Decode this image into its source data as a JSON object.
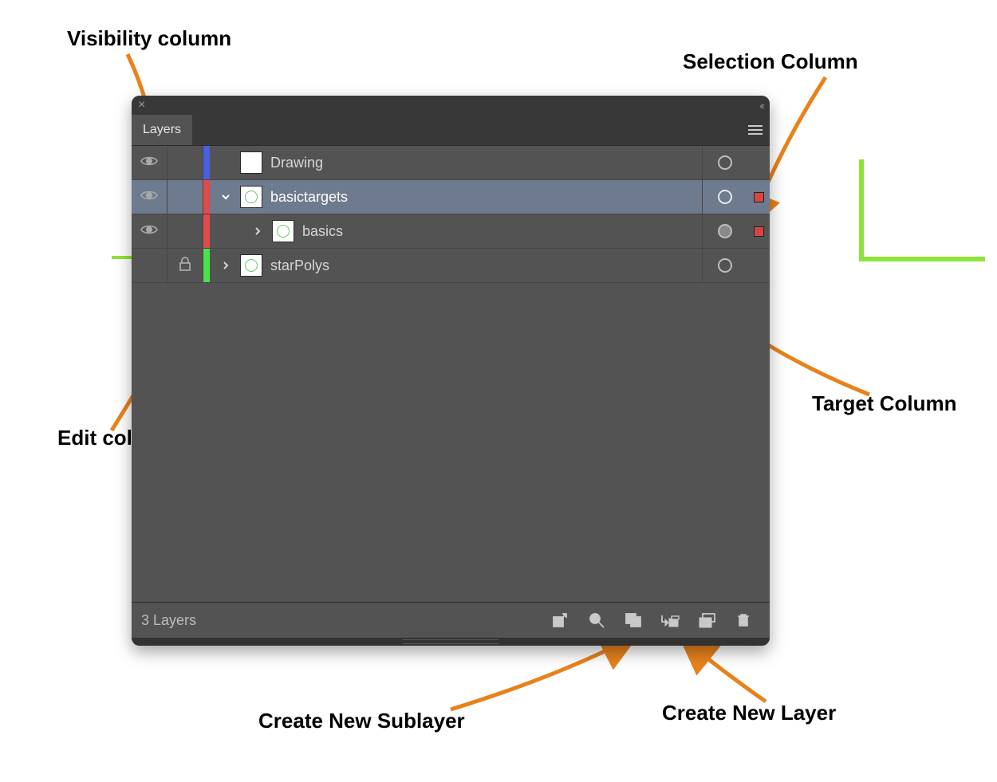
{
  "annotations": {
    "visibility": "Visibility column",
    "selection": "Selection Column",
    "edit": "Edit column",
    "target": "Target Column",
    "new_sublayer": "Create New Sublayer",
    "new_layer": "Create New Layer"
  },
  "panel": {
    "tab_label": "Layers",
    "status_text": "3 Layers"
  },
  "rows": [
    {
      "name": "Drawing",
      "color": "#4a5fe2",
      "visible": true,
      "locked": false,
      "expanded": null,
      "indent": 0,
      "selected": false,
      "has_selection_mark": false,
      "thumb_green": false
    },
    {
      "name": "basictargets",
      "color": "#e24a4a",
      "visible": true,
      "locked": false,
      "expanded": true,
      "indent": 0,
      "selected": true,
      "has_selection_mark": true,
      "sel_color": "#d64545",
      "thumb_green": true
    },
    {
      "name": "basics",
      "color": "#e24a4a",
      "visible": true,
      "locked": false,
      "expanded": false,
      "indent": 1,
      "selected": false,
      "has_selection_mark": true,
      "sel_color": "#d64545",
      "target_filled": true,
      "thumb_green": true
    },
    {
      "name": "starPolys",
      "color": "#4be24a",
      "visible": false,
      "locked": true,
      "expanded": false,
      "indent": 0,
      "selected": false,
      "has_selection_mark": false,
      "thumb_green": true
    }
  ]
}
